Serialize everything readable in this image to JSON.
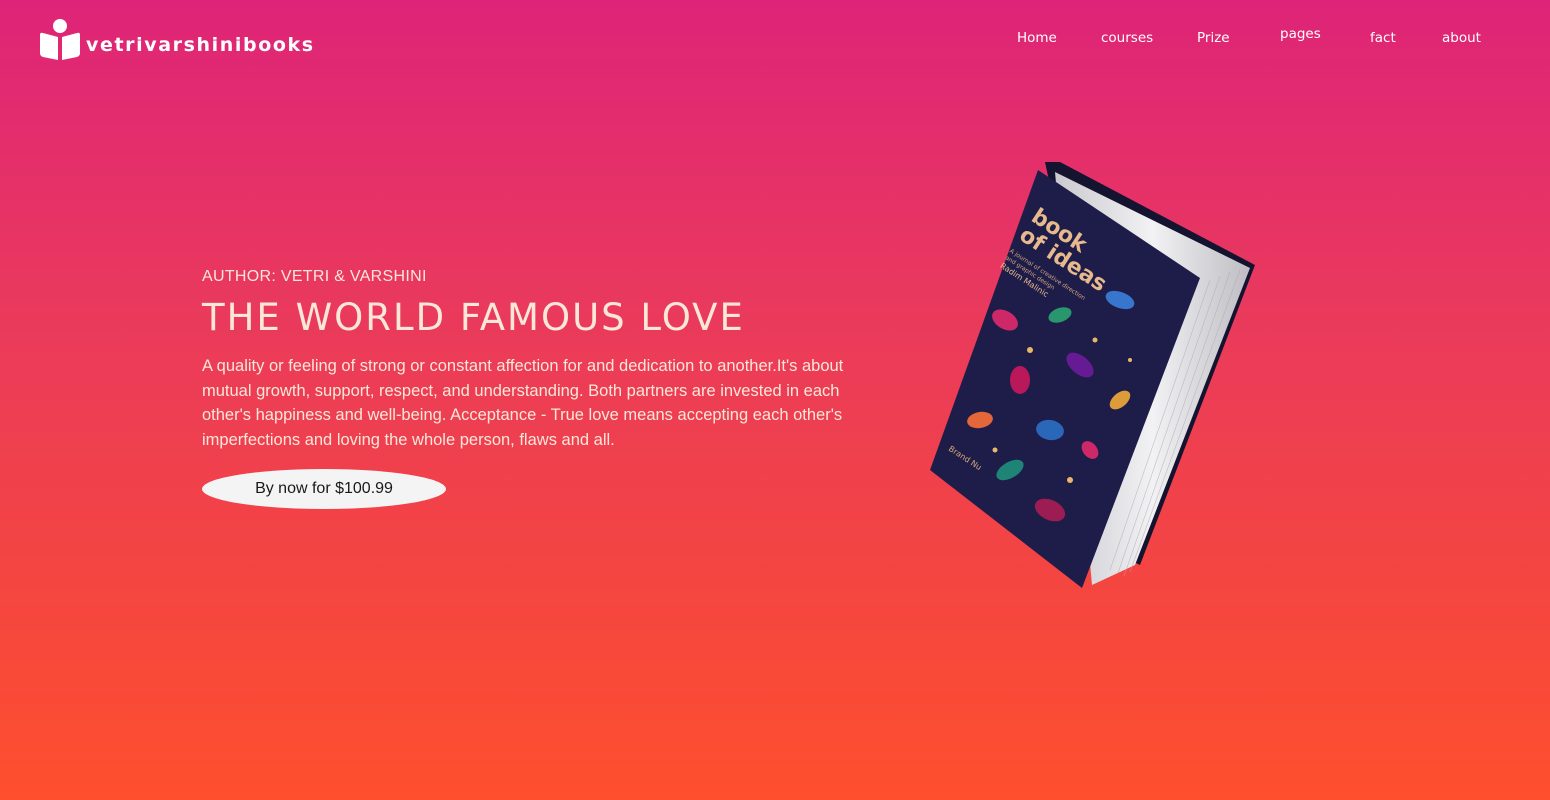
{
  "brand": {
    "name": "vetrivarshinibooks"
  },
  "nav": {
    "items": [
      {
        "label": "Home"
      },
      {
        "label": "courses"
      },
      {
        "label": "Prize"
      },
      {
        "label": "pages"
      },
      {
        "label": "fact"
      },
      {
        "label": "about"
      }
    ]
  },
  "hero": {
    "author": "AUTHOR: VETRI & VARSHINI",
    "title": "THE WORLD FAMOUS LOVE",
    "description": "A quality or feeling of strong or constant affection for and dedication to another.It's about mutual growth, support, respect, and understanding. Both partners are invested in each other's happiness and well-being. Acceptance - True love means accepting each other's imperfections and loving the whole person, flaws and all.",
    "buy_label": "By now for $100.99"
  },
  "book": {
    "cover_title": "book of ideas",
    "cover_subtitle": "A journal of creative direction and graphic design",
    "cover_author": "Radim Malinic",
    "spine_brand": "Brand Nu",
    "cover_color": "#1e1d4a"
  },
  "colors": {
    "gradient_top": "#de2478",
    "gradient_bottom": "#ff4f2e",
    "text_cream": "#fbe7d8"
  }
}
